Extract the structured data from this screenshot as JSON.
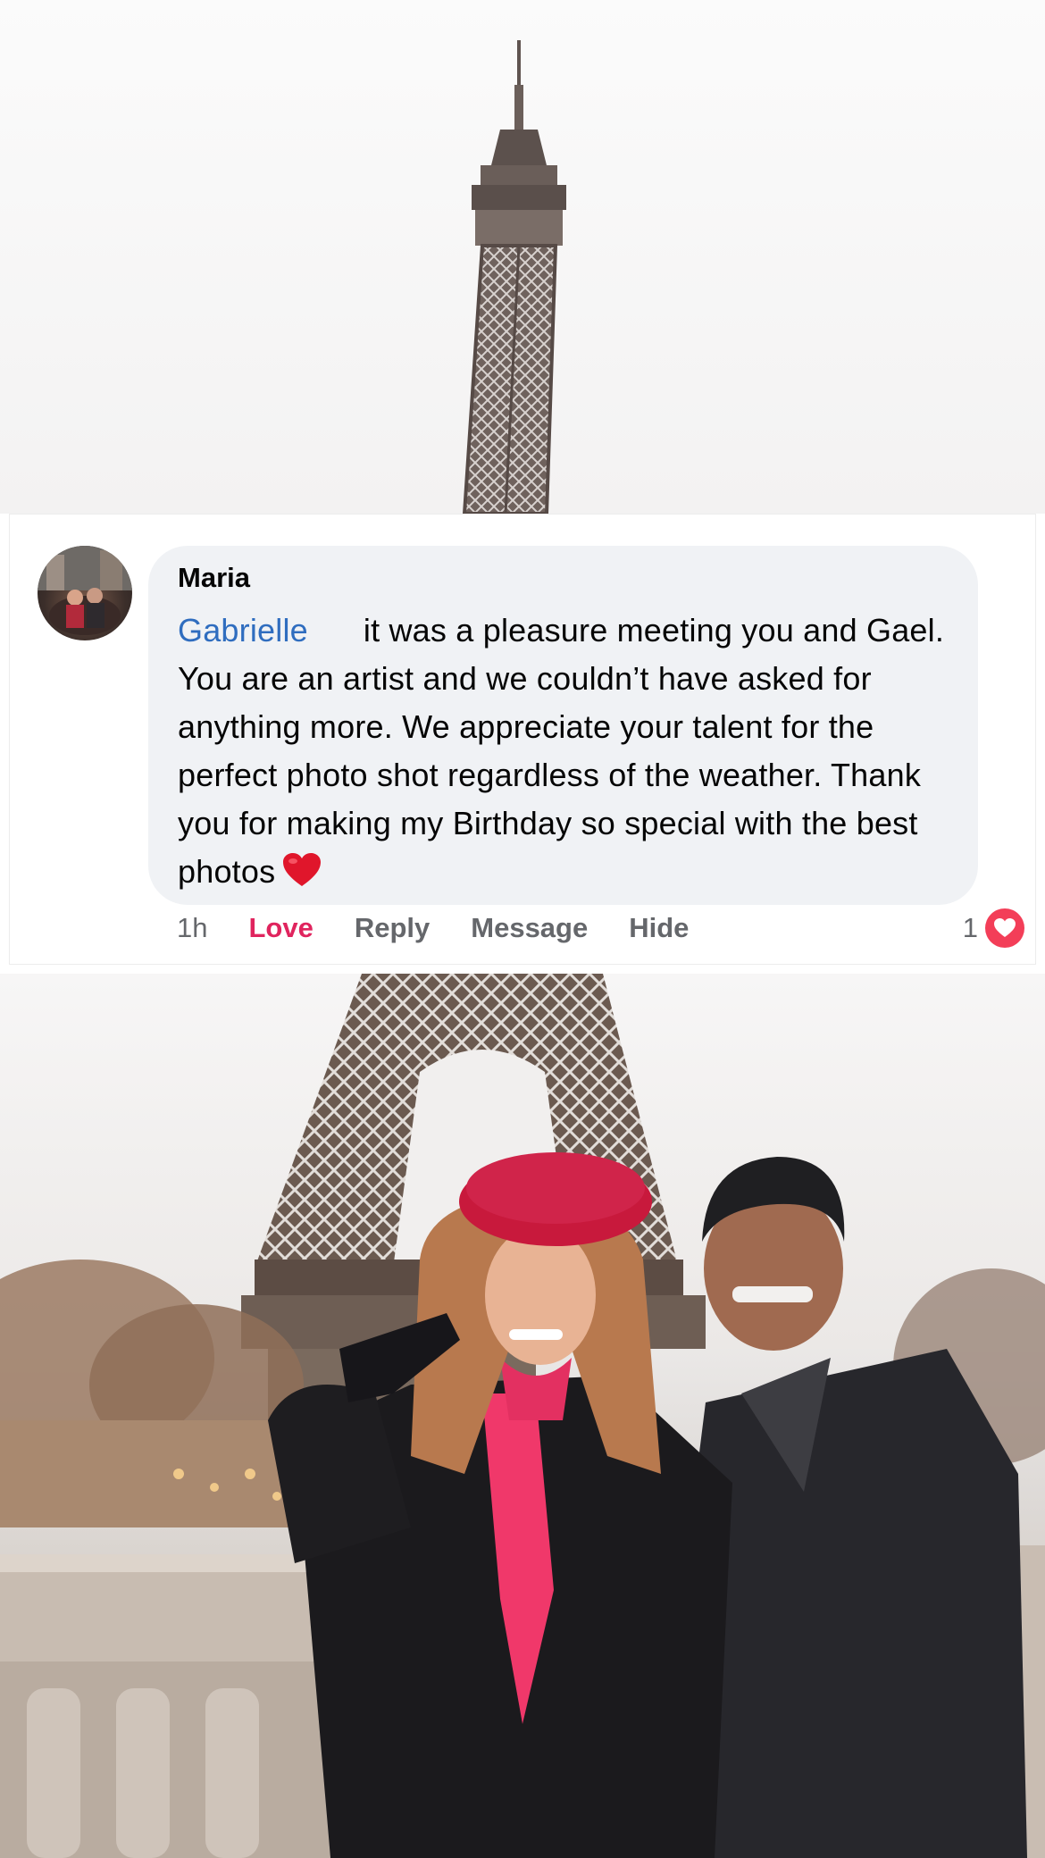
{
  "comment": {
    "author": "Maria",
    "mention": "Gabrielle",
    "text": "it was a pleasure meeting you and Gael. You are an artist and we couldn’t have asked for anything more. We appreciate your talent for the perfect photo shot regardless of the weather. Thank you for making my Birthday so special with the best photos",
    "emoji": "red-heart",
    "time": "1h",
    "actions": {
      "love": "Love",
      "reply": "Reply",
      "message": "Message",
      "hide": "Hide"
    },
    "reaction_count": "1",
    "reaction_type": "love"
  },
  "colors": {
    "bubble_bg": "#f0f2f5",
    "mention": "#2f6dbf",
    "love_text": "#e0245e",
    "love_reaction": "#f33e58",
    "action_text": "#65676b",
    "beret": "#c8193c",
    "scarf": "#f0386a"
  },
  "images": {
    "top": "eiffel-tower-top-photo",
    "bottom": "couple-at-eiffel-tower-photo"
  }
}
